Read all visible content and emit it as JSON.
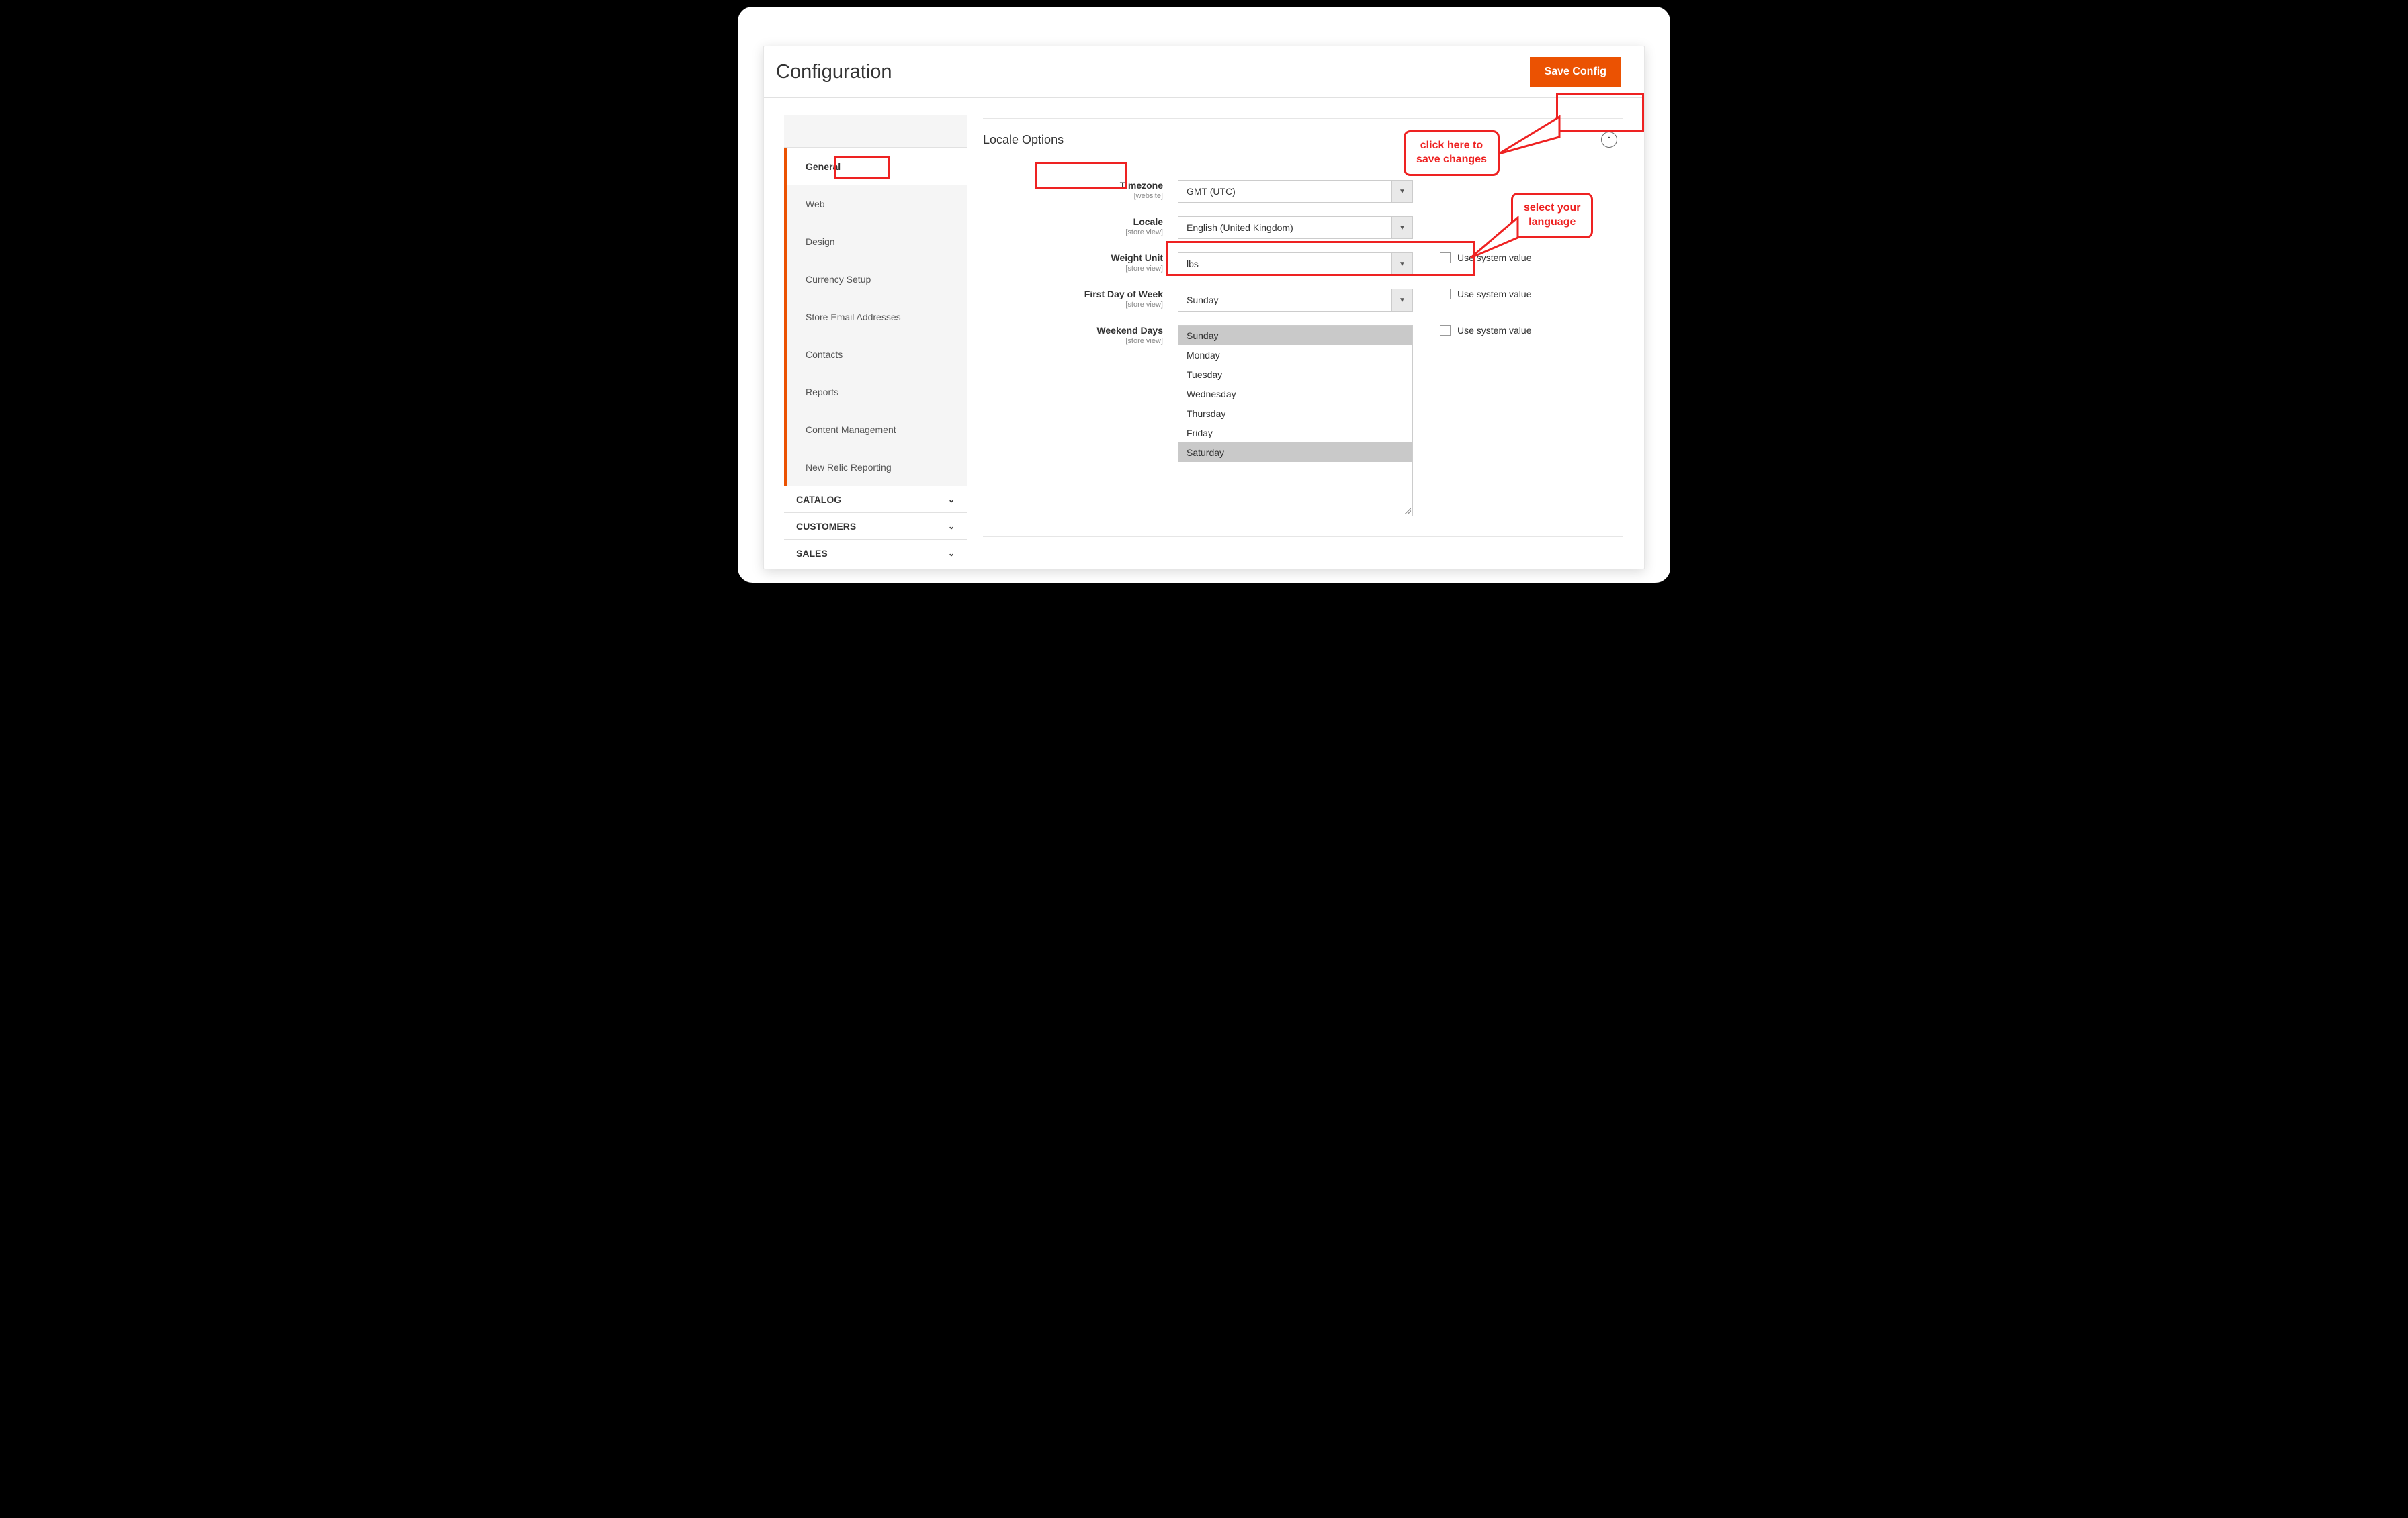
{
  "page": {
    "title": "Configuration"
  },
  "actions": {
    "save": "Save Config"
  },
  "sidebar": {
    "general": {
      "label": "General",
      "active": "General",
      "items": [
        "General",
        "Web",
        "Design",
        "Currency Setup",
        "Store Email Addresses",
        "Contacts",
        "Reports",
        "Content Management",
        "New Relic Reporting"
      ]
    },
    "groups": [
      "CATALOG",
      "CUSTOMERS",
      "SALES"
    ]
  },
  "section": {
    "title": "Locale Options",
    "fields": {
      "timezone": {
        "label": "Timezone",
        "scope": "[website]",
        "value": "GMT (UTC)"
      },
      "locale": {
        "label": "Locale",
        "scope": "[store view]",
        "value": "English (United Kingdom)"
      },
      "weight": {
        "label": "Weight Unit",
        "scope": "[store view]",
        "value": "lbs",
        "sys": "Use system value"
      },
      "firstday": {
        "label": "First Day of Week",
        "scope": "[store view]",
        "value": "Sunday",
        "sys": "Use system value"
      },
      "weekend": {
        "label": "Weekend Days",
        "scope": "[store view]",
        "options": [
          "Sunday",
          "Monday",
          "Tuesday",
          "Wednesday",
          "Thursday",
          "Friday",
          "Saturday"
        ],
        "selected": [
          "Sunday",
          "Saturday"
        ],
        "sys": "Use system value"
      }
    }
  },
  "annotations": {
    "save": "click here to\nsave changes",
    "locale": "select your\nlanguage"
  }
}
